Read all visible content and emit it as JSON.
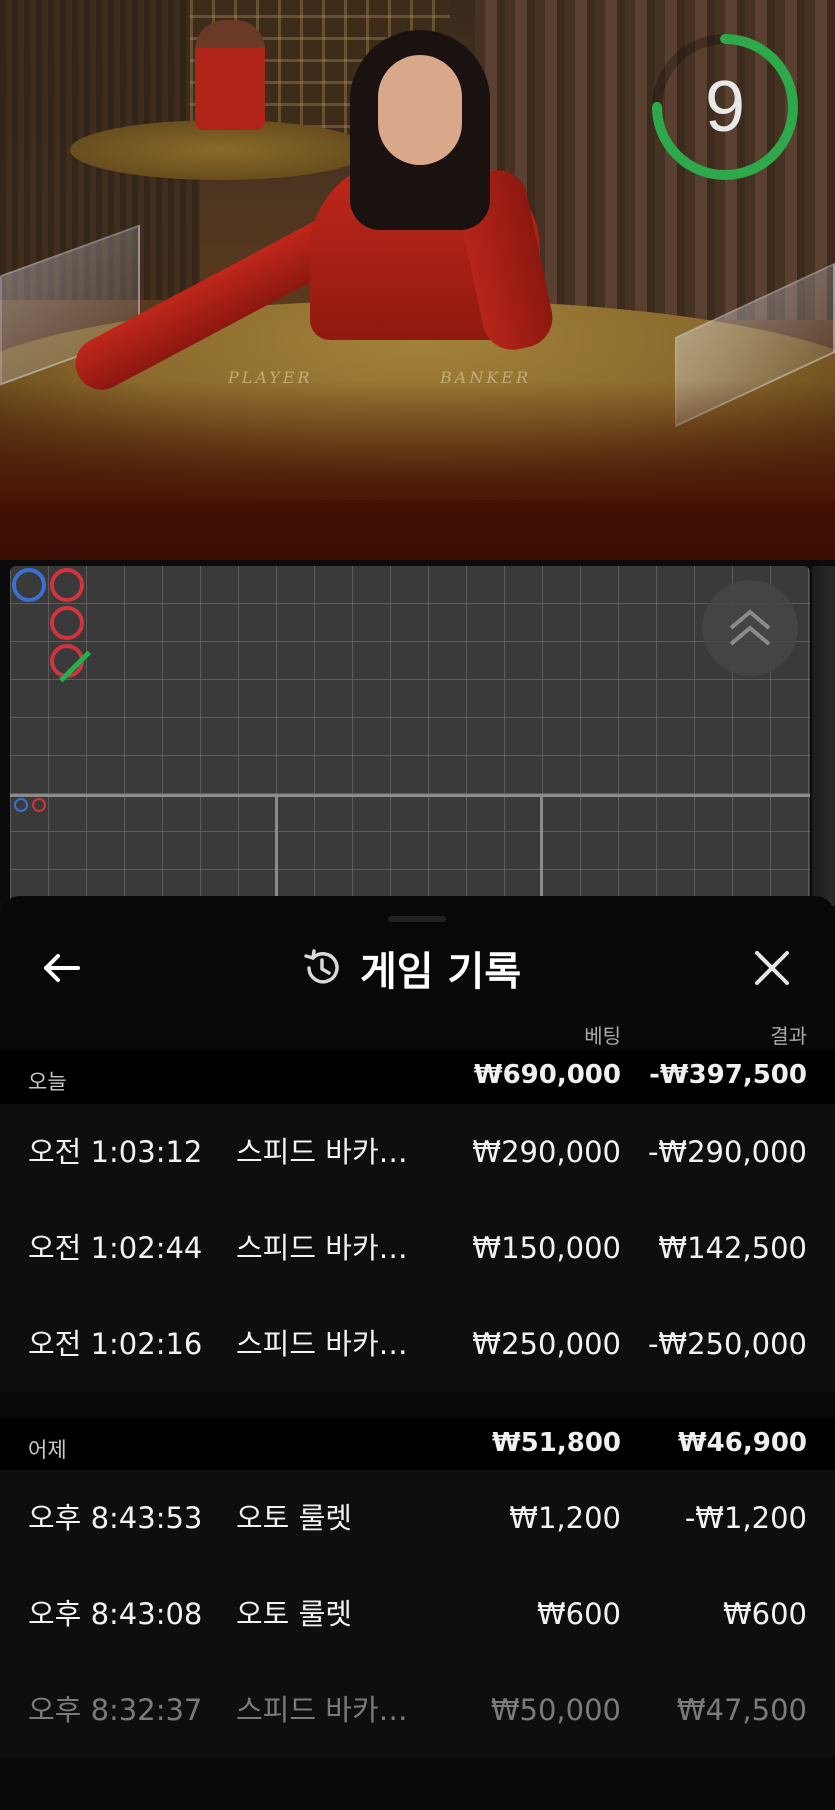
{
  "timer": {
    "value": "9",
    "ring_color": "#2ea84a",
    "progress": 0.75
  },
  "table_labels": {
    "player": "PLAYER",
    "banker": "BANKER"
  },
  "roadmap": {
    "beads": [
      {
        "col": 0,
        "row": 0,
        "side": "player"
      },
      {
        "col": 1,
        "row": 0,
        "side": "banker"
      },
      {
        "col": 1,
        "row": 1,
        "side": "banker"
      },
      {
        "col": 1,
        "row": 2,
        "side": "banker",
        "tie": true
      }
    ],
    "colors": {
      "player": "#3b6fd0",
      "banker": "#d2343d",
      "tie": "#21b04a"
    }
  },
  "panel": {
    "title": "게임 기록",
    "back_icon": "arrow-left-icon",
    "history_icon": "history-clock-icon",
    "close_icon": "close-icon",
    "columns": {
      "bet": "베팅",
      "result": "결과"
    },
    "groups": [
      {
        "label": "오늘",
        "bet_total": "₩690,000",
        "result_total": "-₩397,500",
        "rows": [
          {
            "time": "오전 1:03:12",
            "game": "스피드 바카라...",
            "bet": "₩290,000",
            "result": "-₩290,000"
          },
          {
            "time": "오전 1:02:44",
            "game": "스피드 바카라...",
            "bet": "₩150,000",
            "result": "₩142,500"
          },
          {
            "time": "오전 1:02:16",
            "game": "스피드 바카라...",
            "bet": "₩250,000",
            "result": "-₩250,000"
          }
        ]
      },
      {
        "label": "어제",
        "bet_total": "₩51,800",
        "result_total": "₩46,900",
        "rows": [
          {
            "time": "오후 8:43:53",
            "game": "오토 룰렛",
            "bet": "₩1,200",
            "result": "-₩1,200"
          },
          {
            "time": "오후 8:43:08",
            "game": "오토 룰렛",
            "bet": "₩600",
            "result": "₩600"
          },
          {
            "time": "오후 8:32:37",
            "game": "스피드 바카라...",
            "bet": "₩50,000",
            "result": "₩47,500"
          }
        ]
      }
    ]
  }
}
